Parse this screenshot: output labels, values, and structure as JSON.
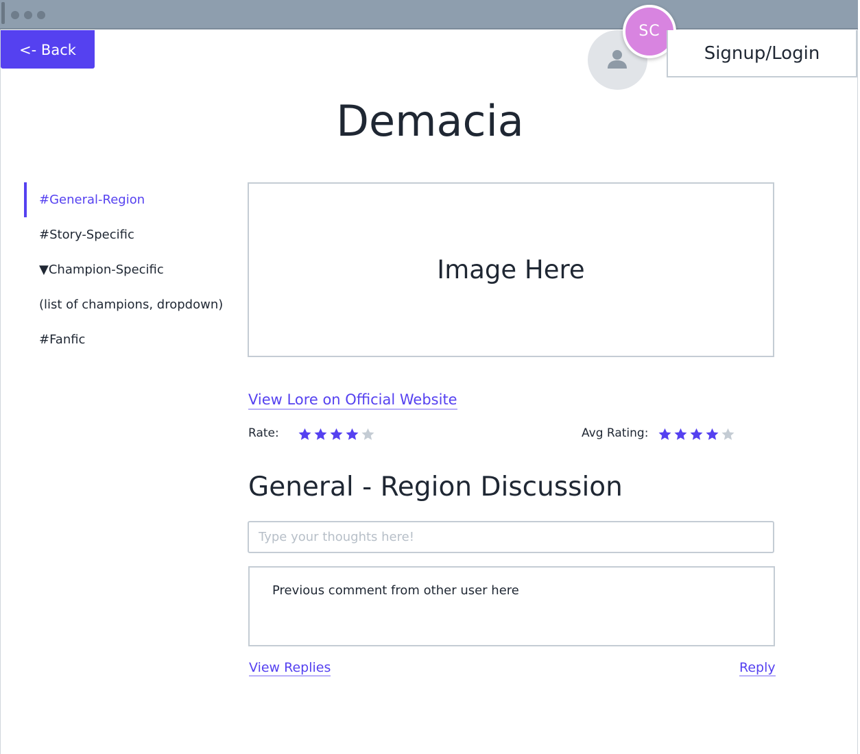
{
  "header": {
    "back_label": "<- Back",
    "avatar_initials": "SC",
    "login_label": "Signup/Login"
  },
  "page": {
    "title": "Demacia"
  },
  "sidebar": {
    "items": [
      {
        "label": "#General-Region",
        "active": true
      },
      {
        "label": "#Story-Specific",
        "active": false
      },
      {
        "label": "▼Champion-Specific",
        "active": false
      },
      {
        "label": "(list of champions, dropdown)",
        "active": false
      },
      {
        "label": "#Fanfic",
        "active": false
      }
    ]
  },
  "main": {
    "image_placeholder": "Image Here",
    "lore_link": "View Lore on Official Website",
    "rate": {
      "label": "Rate:",
      "value": 4,
      "max": 5
    },
    "avg_rating": {
      "label": "Avg Rating:",
      "value": 4,
      "max": 5
    },
    "discussion_title": "General - Region Discussion",
    "comment_placeholder": "Type your thoughts here!",
    "comment_text": "Previous comment from other user here",
    "view_replies_label": "View Replies",
    "reply_label": "Reply"
  },
  "colors": {
    "accent": "#5541f0",
    "titlebar": "#8e9eae",
    "avatar": "#d884e0",
    "star_empty": "#c4ccd4"
  }
}
